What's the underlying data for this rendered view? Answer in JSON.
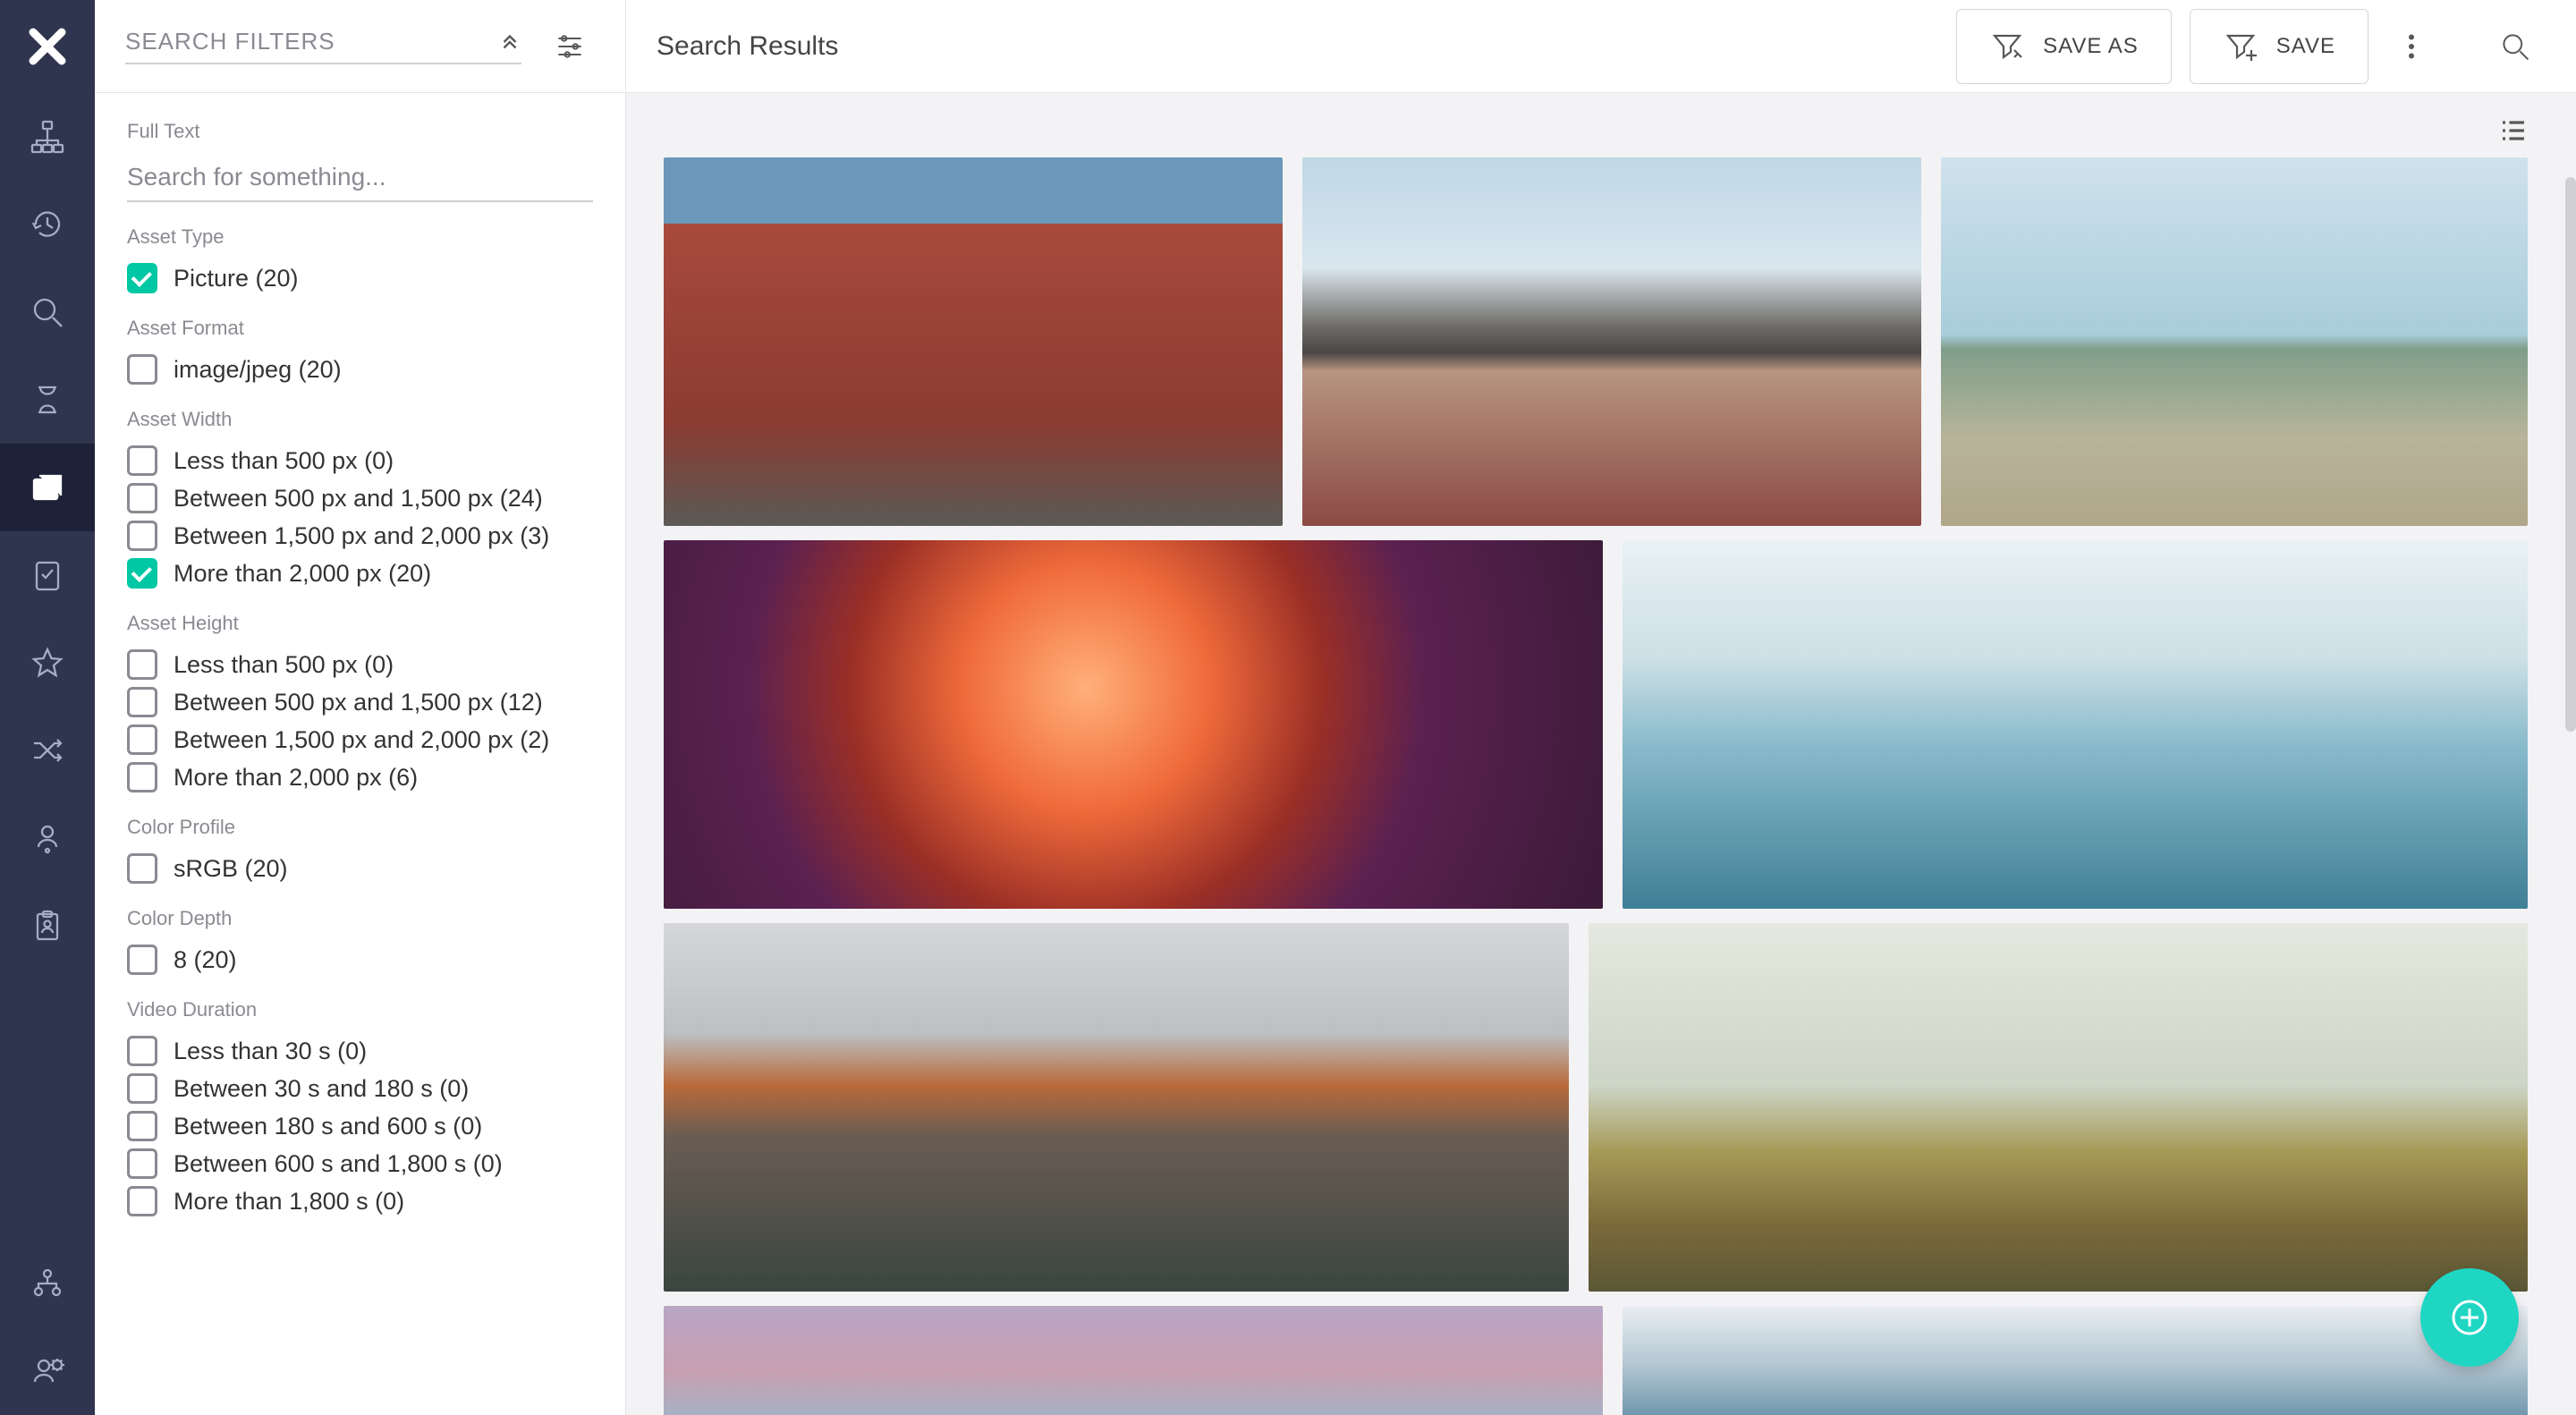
{
  "rail": {
    "items": [
      {
        "name": "tree-icon"
      },
      {
        "name": "history-icon"
      },
      {
        "name": "search-icon"
      },
      {
        "name": "hourglass-icon"
      },
      {
        "name": "images-icon",
        "active": true
      },
      {
        "name": "task-icon"
      },
      {
        "name": "star-icon"
      },
      {
        "name": "shuffle-icon"
      },
      {
        "name": "person-pin-icon"
      },
      {
        "name": "clipboard-user-icon"
      }
    ],
    "footer": [
      {
        "name": "org-icon"
      },
      {
        "name": "user-settings-icon"
      }
    ]
  },
  "filters": {
    "title": "SEARCH FILTERS",
    "fulltext_label": "Full Text",
    "fulltext_placeholder": "Search for something...",
    "groups": [
      {
        "label": "Asset Type",
        "options": [
          {
            "label": "Picture (20)",
            "checked": true
          }
        ]
      },
      {
        "label": "Asset Format",
        "options": [
          {
            "label": "image/jpeg (20)",
            "checked": false
          }
        ]
      },
      {
        "label": "Asset Width",
        "options": [
          {
            "label": "Less than 500 px (0)",
            "checked": false
          },
          {
            "label": "Between 500 px and 1,500 px (24)",
            "checked": false
          },
          {
            "label": "Between 1,500 px and 2,000 px (3)",
            "checked": false
          },
          {
            "label": "More than 2,000 px (20)",
            "checked": true
          }
        ]
      },
      {
        "label": "Asset Height",
        "options": [
          {
            "label": "Less than 500 px (0)",
            "checked": false
          },
          {
            "label": "Between 500 px and 1,500 px (12)",
            "checked": false
          },
          {
            "label": "Between 1,500 px and 2,000 px (2)",
            "checked": false
          },
          {
            "label": "More than 2,000 px (6)",
            "checked": false
          }
        ]
      },
      {
        "label": "Color Profile",
        "options": [
          {
            "label": "sRGB (20)",
            "checked": false
          }
        ]
      },
      {
        "label": "Color Depth",
        "options": [
          {
            "label": "8 (20)",
            "checked": false
          }
        ]
      },
      {
        "label": "Video Duration",
        "options": [
          {
            "label": "Less than 30 s (0)",
            "checked": false
          },
          {
            "label": "Between 30 s and 180 s (0)",
            "checked": false
          },
          {
            "label": "Between 180 s and 600 s (0)",
            "checked": false
          },
          {
            "label": "Between 600 s and 1,800 s (0)",
            "checked": false
          },
          {
            "label": "More than 1,800 s (0)",
            "checked": false
          }
        ]
      }
    ]
  },
  "topbar": {
    "title": "Search Results",
    "save_as_label": "SAVE AS",
    "save_label": "SAVE"
  },
  "results": {
    "rows": [
      [
        {
          "img": "street-houses"
        },
        {
          "img": "mountain-lake"
        },
        {
          "img": "geyser-plain"
        }
      ],
      [
        {
          "img": "canyon-swirl"
        },
        {
          "img": "frozen-trees"
        }
      ],
      [
        {
          "img": "yosemite-sunset"
        },
        {
          "img": "autumn-mist"
        }
      ],
      [
        {
          "img": "purple-clouds"
        },
        {
          "img": "blue-ridges"
        }
      ]
    ]
  }
}
